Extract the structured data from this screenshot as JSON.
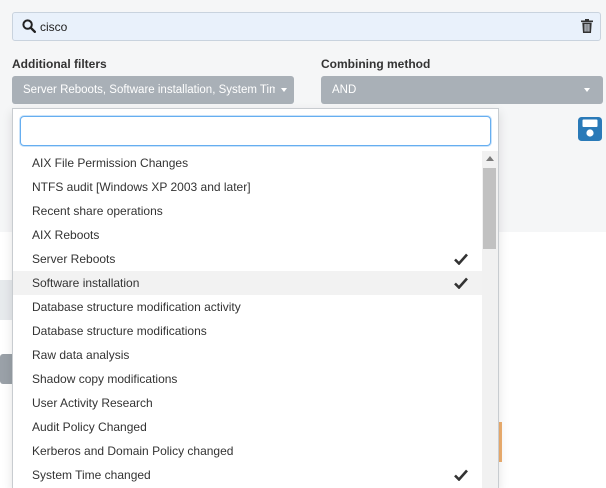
{
  "search": {
    "query": "cisco"
  },
  "filters": {
    "label": "Additional filters",
    "selected": "Server Reboots, Software installation, System Time changed"
  },
  "combining": {
    "label": "Combining method",
    "selected": "AND"
  },
  "dropdown": {
    "filter_value": "",
    "items": [
      {
        "label": "AIX File Permission Changes",
        "checked": false
      },
      {
        "label": "NTFS audit [Windows XP 2003 and later]",
        "checked": false
      },
      {
        "label": "Recent share operations",
        "checked": false
      },
      {
        "label": "AIX Reboots",
        "checked": false
      },
      {
        "label": "Server Reboots",
        "checked": true
      },
      {
        "label": "Software installation",
        "checked": true
      },
      {
        "label": "Database structure modification activity",
        "checked": false
      },
      {
        "label": "Database structure modifications",
        "checked": false
      },
      {
        "label": "Raw data analysis",
        "checked": false
      },
      {
        "label": "Shadow copy modifications",
        "checked": false
      },
      {
        "label": "User Activity Research",
        "checked": false
      },
      {
        "label": "Audit Policy Changed",
        "checked": false
      },
      {
        "label": "Kerberos and Domain Policy changed",
        "checked": false
      },
      {
        "label": "System Time changed",
        "checked": true
      }
    ],
    "hover_index": 5
  },
  "colors": {
    "accent": "#2a7ab8",
    "select_bg": "#a9b0b7",
    "search_bg": "#e9f1fb"
  },
  "icons": {
    "search": "search-icon",
    "trash": "trash-icon",
    "save": "save-icon",
    "check": "check-icon"
  }
}
